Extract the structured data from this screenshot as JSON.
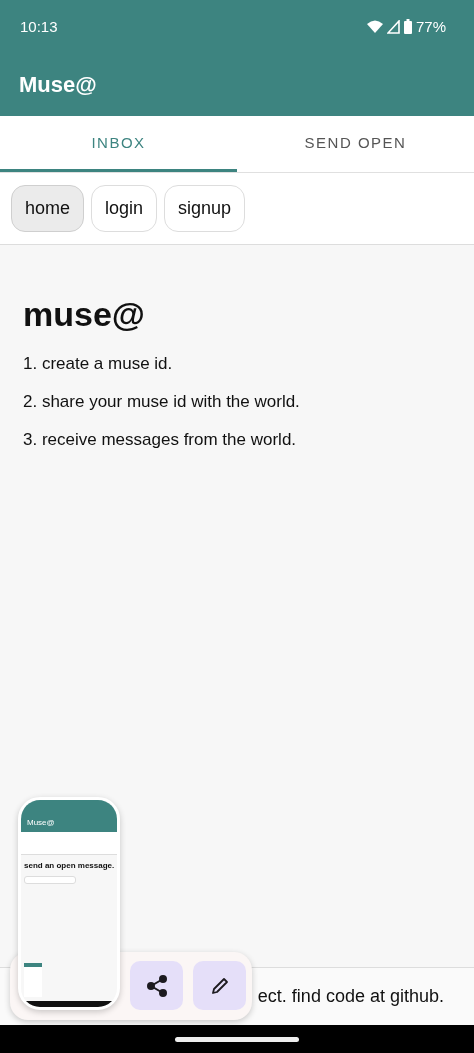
{
  "status_bar": {
    "time": "10:13",
    "battery": "77%"
  },
  "app_bar": {
    "title": "Muse@"
  },
  "tabs": [
    {
      "label": "INBOX",
      "selected": true
    },
    {
      "label": "SEND OPEN",
      "selected": false
    }
  ],
  "nav_chips": [
    {
      "label": "home",
      "selected": true
    },
    {
      "label": "login",
      "selected": false
    },
    {
      "label": "signup",
      "selected": false
    }
  ],
  "content": {
    "heading": "muse@",
    "steps": [
      "1. create a muse id.",
      "2. share your muse id with the world.",
      "3. receive messages from the world."
    ]
  },
  "footer": {
    "text": "ect. find code at github."
  },
  "screenshot_preview": {
    "app_title": "Muse@",
    "heading": "send an open message."
  }
}
